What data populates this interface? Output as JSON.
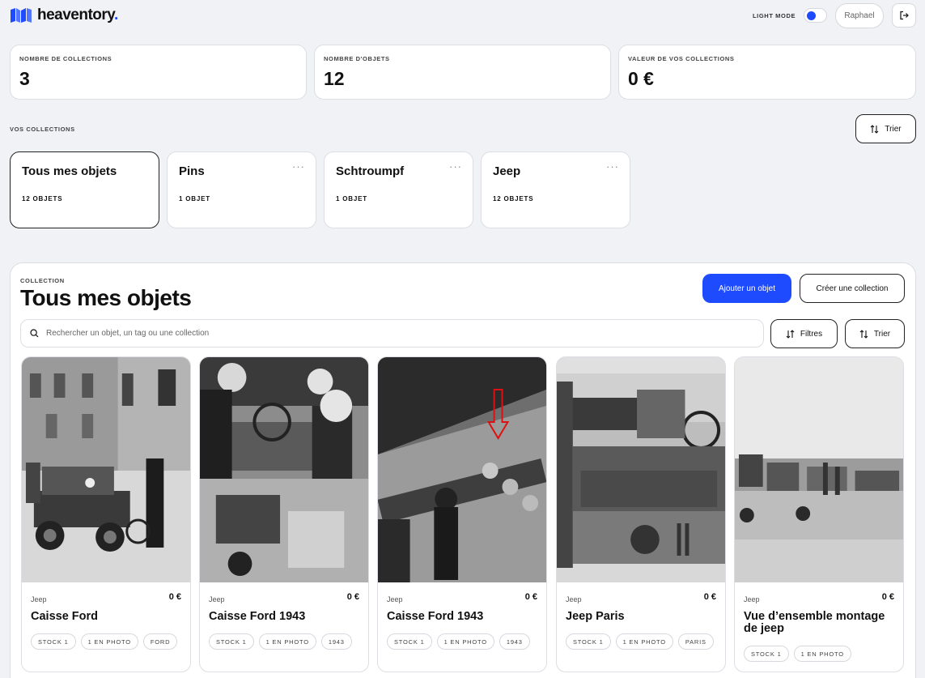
{
  "header": {
    "logo_text": "heaventory",
    "logo_dot": ".",
    "theme_label": "LIGHT MODE",
    "user_label": "Raphael"
  },
  "stats": [
    {
      "label": "NOMBRE DE COLLECTIONS",
      "value": "3"
    },
    {
      "label": "NOMBRE D'OBJETS",
      "value": "12"
    },
    {
      "label": "VALEUR DE VOS COLLECTIONS",
      "value": "0 €"
    }
  ],
  "collections_section": {
    "label": "VOS COLLECTIONS",
    "sort_label": "Trier",
    "cards": [
      {
        "name": "Tous mes objets",
        "count": "12 OBJETS"
      },
      {
        "name": "Pins",
        "count": "1 OBJET",
        "more": "···"
      },
      {
        "name": "Schtroumpf",
        "count": "1 OBJET",
        "more": "···"
      },
      {
        "name": "Jeep",
        "count": "12 OBJETS",
        "more": "···"
      }
    ]
  },
  "panel": {
    "kicker": "COLLECTION",
    "title": "Tous mes objets",
    "add_label": "Ajouter un objet",
    "create_label": "Créer une collection",
    "search_placeholder": "Rechercher un objet, un tag ou une collection",
    "filters_label": "Filtres",
    "sort_label": "Trier"
  },
  "items": [
    {
      "collection": "Jeep",
      "price": "0 €",
      "title": "Caisse Ford",
      "tags": [
        "STOCK 1",
        "1 EN PHOTO",
        "FORD"
      ]
    },
    {
      "collection": "Jeep",
      "price": "0 €",
      "title": "Caisse Ford 1943",
      "tags": [
        "STOCK 1",
        "1 EN PHOTO",
        "1943"
      ]
    },
    {
      "collection": "Jeep",
      "price": "0 €",
      "title": "Caisse Ford 1943",
      "tags": [
        "STOCK 1",
        "1 EN PHOTO",
        "1943"
      ]
    },
    {
      "collection": "Jeep",
      "price": "0 €",
      "title": "Jeep Paris",
      "tags": [
        "STOCK 1",
        "1 EN PHOTO",
        "PARIS"
      ]
    },
    {
      "collection": "Jeep",
      "price": "0 €",
      "title": "Vue d’ensemble montage de jeep",
      "tags": [
        "STOCK 1",
        "1 EN PHOTO"
      ]
    }
  ],
  "colors": {
    "accent": "#1f4bff",
    "background": "#f1f2f6"
  }
}
